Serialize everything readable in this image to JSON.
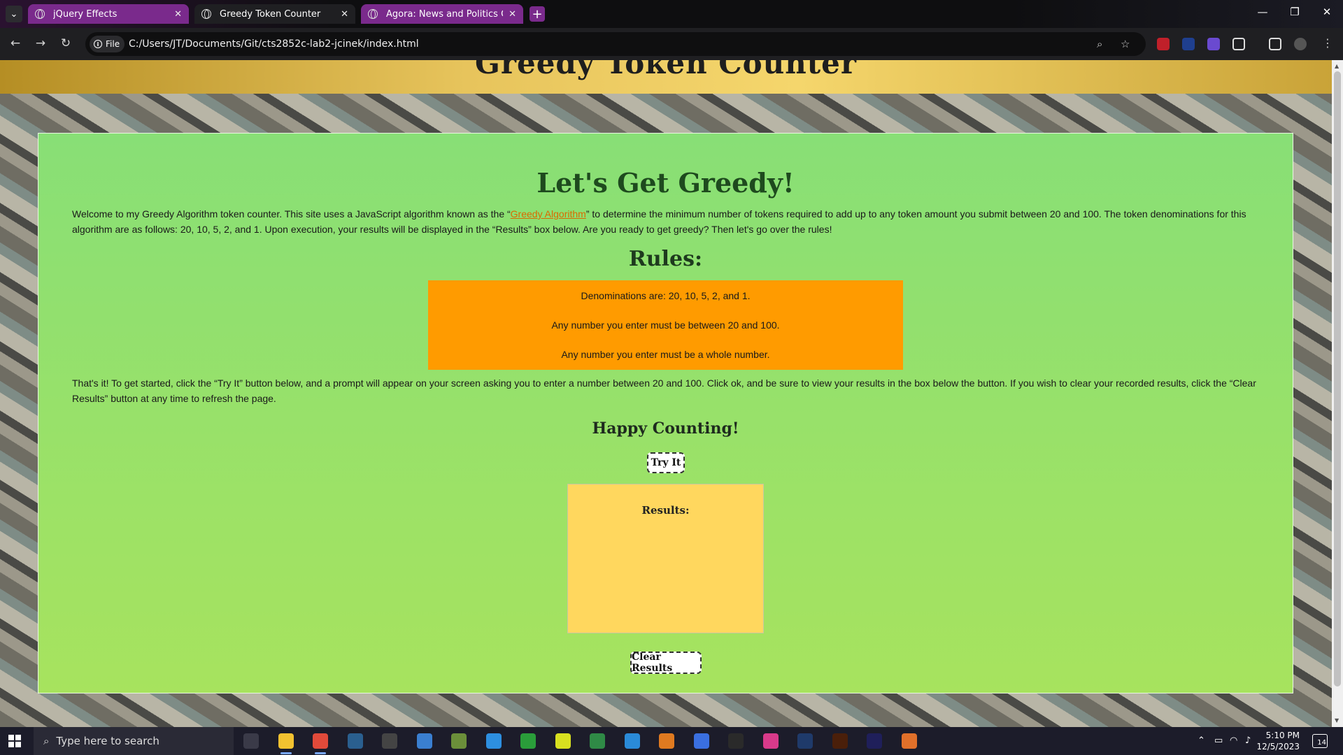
{
  "browser": {
    "tabs": [
      {
        "label": "jQuery Effects",
        "style": "purple"
      },
      {
        "label": "Greedy Token Counter",
        "style": "active"
      },
      {
        "label": "Agora: News and Politics Chat",
        "style": "purple"
      }
    ],
    "new_tab_symbol": "+",
    "window_controls": {
      "minimize": "—",
      "restore": "❐",
      "close": "✕"
    },
    "address_chip": "File",
    "url": "C:/Users/JT/Documents/Git/cts2852c-lab2-jcinek/index.html",
    "nav": {
      "back": "←",
      "forward": "→",
      "reload": "↻"
    }
  },
  "page": {
    "header_title": "Greedy Token Counter",
    "main_heading": "Let's Get Greedy!",
    "intro_before": "Welcome to my Greedy Algorithm token counter. This site uses a JavaScript algorithm known as the “",
    "intro_link": "Greedy Algorithm",
    "intro_after": "” to determine the minimum number of tokens required to add up to any token amount you submit between 20 and 100. The token denominations for this algorithm are as follows: 20, 10, 5, 2, and 1. Upon execution, your results will be displayed in the “Results” box below. Are you ready to get greedy? Then let's go over the rules!",
    "rules_heading": "Rules:",
    "rules": [
      "Denominations are: 20, 10, 5, 2, and 1.",
      "Any number you enter must be between 20 and 100.",
      "Any number you enter must be a whole number."
    ],
    "instructions": "That's it! To get started, click the “Try It” button below, and a prompt will appear on your screen asking you to enter a number between 20 and 100. Click ok, and be sure to view your results in the box below the button. If you wish to clear your recorded results, click the “Clear Results” button at any time to refresh the page.",
    "happy_heading": "Happy Counting!",
    "try_button": "Try It",
    "results_label": "Results:",
    "clear_button": "Clear Results"
  },
  "taskbar": {
    "search_placeholder": "Type here to search",
    "time": "5:10 PM",
    "date": "12/5/2023",
    "notification_count": "14",
    "apps": [
      {
        "name": "task-view",
        "color": "#3a3a48"
      },
      {
        "name": "file-explorer",
        "color": "#f2c230"
      },
      {
        "name": "chrome",
        "color": "#e04a3a"
      },
      {
        "name": "steam",
        "color": "#2a5f8f"
      },
      {
        "name": "epic-games",
        "color": "#444444"
      },
      {
        "name": "microsoft-store",
        "color": "#3a7fd0"
      },
      {
        "name": "minecraft",
        "color": "#6b8f3a"
      },
      {
        "name": "folder-blue",
        "color": "#2d8fe0"
      },
      {
        "name": "xbox",
        "color": "#2a9d3a"
      },
      {
        "name": "pycharm",
        "color": "#d8e020"
      },
      {
        "name": "excel",
        "color": "#2f8a46"
      },
      {
        "name": "vscode",
        "color": "#2a8ad8"
      },
      {
        "name": "blender",
        "color": "#e07a20"
      },
      {
        "name": "edge-app",
        "color": "#3a6fe0"
      },
      {
        "name": "obs",
        "color": "#2a2a2a"
      },
      {
        "name": "instagram",
        "color": "#d83a8a"
      },
      {
        "name": "photoshop",
        "color": "#1f3a6a"
      },
      {
        "name": "illustrator",
        "color": "#4a1f0a"
      },
      {
        "name": "after-effects",
        "color": "#1f1f5a"
      },
      {
        "name": "firefox",
        "color": "#e0702a"
      }
    ]
  },
  "colors": {
    "accent_purple": "#7a2a8c",
    "page_green": "#88df76",
    "rules_orange": "#ff9b00",
    "results_yellow": "#ffd75e",
    "header_gold": "#e7c45c",
    "link_orange": "#d96a00"
  }
}
